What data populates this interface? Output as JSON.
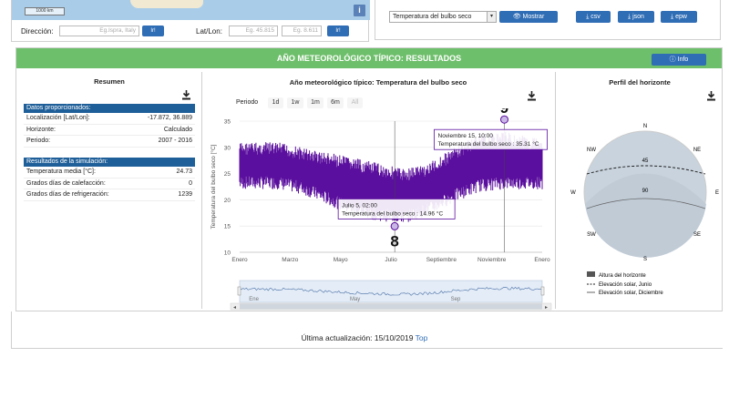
{
  "top_left": {
    "scale_label": "1000 km",
    "info_icon": "i",
    "direccion_label": "Dirección:",
    "direccion_placeholder": "Eg.Ispra, Italy",
    "ir_label": "Ir!",
    "latlon_label": "Lat/Lon:",
    "lat_placeholder": "Eg. 45.815",
    "lon_placeholder": "Eg. 8.611",
    "ir2_label": "Ir!"
  },
  "top_right": {
    "variable_selected": "Temperatura del bulbo seco",
    "mostrar_label": "Mostrar",
    "csv_label": "csv",
    "json_label": "json",
    "epw_label": "epw"
  },
  "main": {
    "title": "AÑO METEOROLÓGICO TÍPICO: RESULTADOS",
    "info_label": "Info"
  },
  "resumen": {
    "title": "Resumen",
    "datos_header": "Datos proporcionados:",
    "datos_rows": [
      {
        "k": "Localización [Lat/Lon]:",
        "v": "-17.872, 36.889"
      },
      {
        "k": "Horizonte:",
        "v": "Calculado"
      },
      {
        "k": "Periodo:",
        "v": "2007 - 2016"
      }
    ],
    "sim_header": "Resultados de la simulación:",
    "sim_rows": [
      {
        "k": "Temperatura media [°C]:",
        "v": "24.73"
      },
      {
        "k": "Grados días de calefacción:",
        "v": "0"
      },
      {
        "k": "Grados días de refrigeración:",
        "v": "1239"
      }
    ]
  },
  "chart_panel": {
    "title": "Año meteorológico típico: Temperatura del bulbo seco",
    "periodo_label": "Periodo",
    "period_buttons": [
      "1d",
      "1w",
      "1m",
      "6m",
      "All"
    ],
    "tooltip_max_date": "Noviembre 15, 10:00",
    "tooltip_max_text": "Temperatura del bulbo seco : 35.31 °C",
    "tooltip_min_date": "Julio 5, 02:00",
    "tooltip_min_text": "Temperatura del bulbo seco : 14.96 °C",
    "marker_max": "9",
    "marker_min": "8",
    "navigator_labels": [
      "Ene",
      "May",
      "Sep"
    ]
  },
  "chart_data": {
    "type": "line",
    "ylabel": "Temperatura del bulbo seco [°C]",
    "ylim": [
      10,
      35
    ],
    "yticks": [
      10,
      15,
      20,
      25,
      30,
      35
    ],
    "xticks": [
      "Enero",
      "Marzo",
      "Mayo",
      "Julio",
      "Septiembre",
      "Noviembre",
      "Enero"
    ],
    "series": [
      {
        "color": "#5b0f9e",
        "monthly_low": [
          22,
          22,
          21,
          19,
          17,
          16,
          15.5,
          17,
          19.5,
          21.5,
          22,
          22
        ],
        "monthly_high": [
          31,
          31,
          30,
          29,
          28,
          27,
          26,
          27,
          30,
          32.5,
          33,
          32
        ],
        "max_point": {
          "month": 10.5,
          "value": 35.31
        },
        "min_point": {
          "month": 6.15,
          "value": 14.96
        }
      }
    ]
  },
  "horizon": {
    "title": "Perfil del horizonte",
    "directions": {
      "N": "N",
      "NE": "NE",
      "E": "E",
      "SE": "SE",
      "S": "S",
      "SW": "SW",
      "W": "W",
      "NW": "NW"
    },
    "ring_45": "45",
    "ring_90": "90",
    "legend": [
      "Altura del horizonte",
      "Elevación solar, Junio",
      "Elevación solar, Diciembre"
    ]
  },
  "footer": {
    "text": "Última actualización: 15/10/2019",
    "top_link": "Top"
  }
}
